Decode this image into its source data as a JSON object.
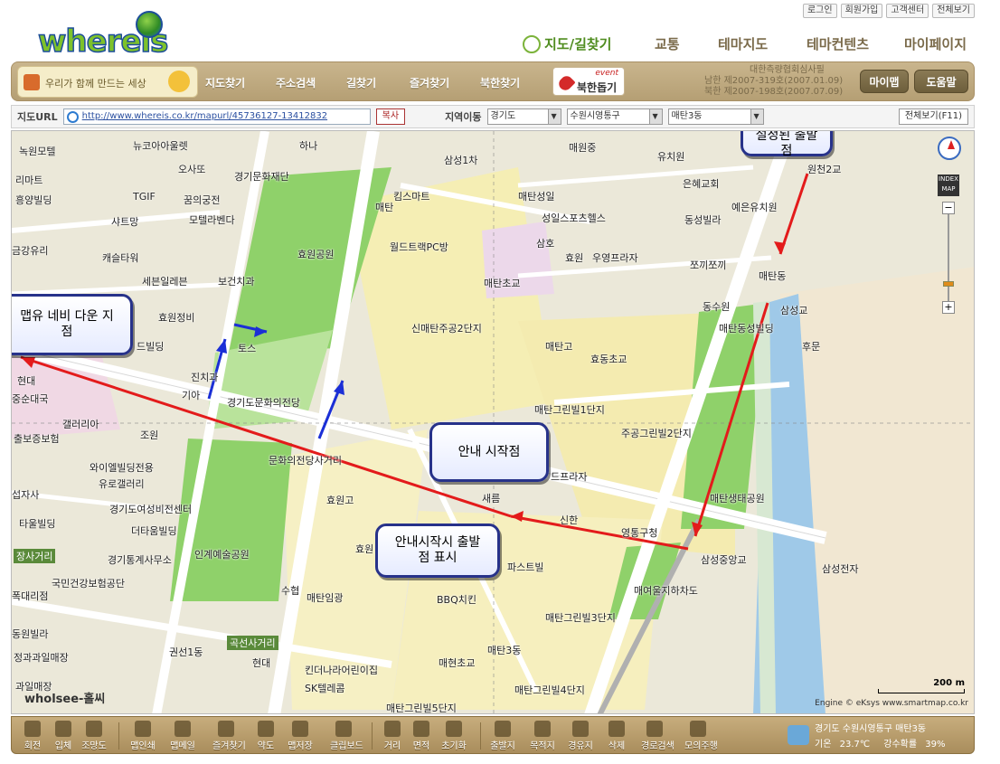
{
  "header": {
    "logo_text": "whereis",
    "util_links": [
      "로그인",
      "회원가입",
      "고객센터",
      "전체보기"
    ],
    "main_nav": [
      "지도/길찾기",
      "교통",
      "테마지도",
      "테마컨텐츠",
      "마이페이지"
    ]
  },
  "subbar": {
    "banner": "우리가 함께 만드는 세상",
    "menu": [
      "지도찾기",
      "주소검색",
      "길찾기",
      "즐겨찾기",
      "북한찾기"
    ],
    "event_tag": "event",
    "event_label": "북한돕기",
    "registration_1": "대한측량협회심사필",
    "registration_2": "남한 제2007-319호(2007.01.09)",
    "registration_3": "북한 제2007-198호(2007.07.09)",
    "mymap_label": "마이맵",
    "help_label": "도움말"
  },
  "urlbar": {
    "label": "지도URL",
    "url": "http://www.whereis.co.kr/mapurl/45736127-13412832",
    "copy_label": "복사",
    "region_label": "지역이동",
    "region_1": "경기도",
    "region_2": "수원시영통구",
    "region_3": "매탄3동",
    "fullview_label": "전체보기(F11)"
  },
  "map": {
    "callouts": {
      "start_set": "설정된 출발\n점",
      "manual_navi": "맵유 네비 다운 지\n점",
      "guide_start": "안내 시작점",
      "guide_start_display": "안내시작시 출발\n점 표시"
    },
    "labels": [
      "녹원모텔",
      "뉴코아아울렛",
      "하나",
      "매원중",
      "유치원",
      "원천2교",
      "리마트",
      "오사또",
      "경기문화재단",
      "삼성1차",
      "TGIF",
      "꿈의궁전",
      "킴스마트",
      "매탄성일",
      "은혜교회",
      "예은유치원",
      "흥양빌딩",
      "샤트망",
      "모텔라벤다",
      "매탄",
      "성일스포츠헬스",
      "동성빌라",
      "효원공원",
      "월드트랙PC방",
      "삼호",
      "금강유리",
      "캐슬타워",
      "효원",
      "우영프라자",
      "쪼끼쪼끼",
      "매탄동",
      "세븐일레븐",
      "보건치과",
      "매탄초교",
      "동수원",
      "삼성교",
      "효원정비",
      "신매탄주공2단지",
      "매탄동성빌딩",
      "후문",
      "드빌딩",
      "토스",
      "매탄고",
      "효동초교",
      "진치과",
      "기아",
      "현대",
      "중순대국",
      "경기도문화의전당",
      "매탄그린빌1단지",
      "갤러리아",
      "주공그린빌2단지",
      "조원",
      "출보증보험",
      "와이엘빌딩전용",
      "유로갤러리",
      "문화의전당사거리",
      "효원고",
      "드프라자",
      "새름",
      "신한",
      "영통구청",
      "매탄생태공원",
      "섭자사",
      "경기도여성비전센터",
      "타울빌딩",
      "더타움빌딩",
      "인계예술공원",
      "장사거리",
      "경기통계사무소",
      "국민건강보험공단",
      "효원",
      "파스트빌",
      "삼성중앙교",
      "폭대리점",
      "수협",
      "매탄임광",
      "BBQ치킨",
      "매여울지하차도",
      "삼성전자",
      "동원빌라",
      "매탄그린빌3단지",
      "곡선사거리",
      "권선1동",
      "매탄3동",
      "정과과일매장",
      "현대",
      "매현초교",
      "킨더나라어린이집",
      "SK텔레콤",
      "매탄그린빌5단지",
      "매탄그린빌4단지",
      "과일매장"
    ],
    "scale_label": "200 m",
    "engine_label": "Engine © eKsys www.smartmap.co.kr",
    "watermark": "wholsee-홀씨",
    "zoom_index": "INDEX MAP"
  },
  "toolbar": {
    "tools": [
      "회전",
      "입체",
      "조망도",
      "맵인쇄",
      "맵메일",
      "즐겨찾기",
      "약도",
      "맵저장",
      "클립보드",
      "거리",
      "면적",
      "초기화",
      "출발지",
      "목적지",
      "경유지",
      "삭제",
      "경로검색",
      "모의주행"
    ],
    "weather_location": "경기도 수원시영통구 매탄3동",
    "weather_temp_label": "기온",
    "weather_temp": "23.7℃",
    "weather_rain_label": "강수확률",
    "weather_rain": "39%"
  }
}
